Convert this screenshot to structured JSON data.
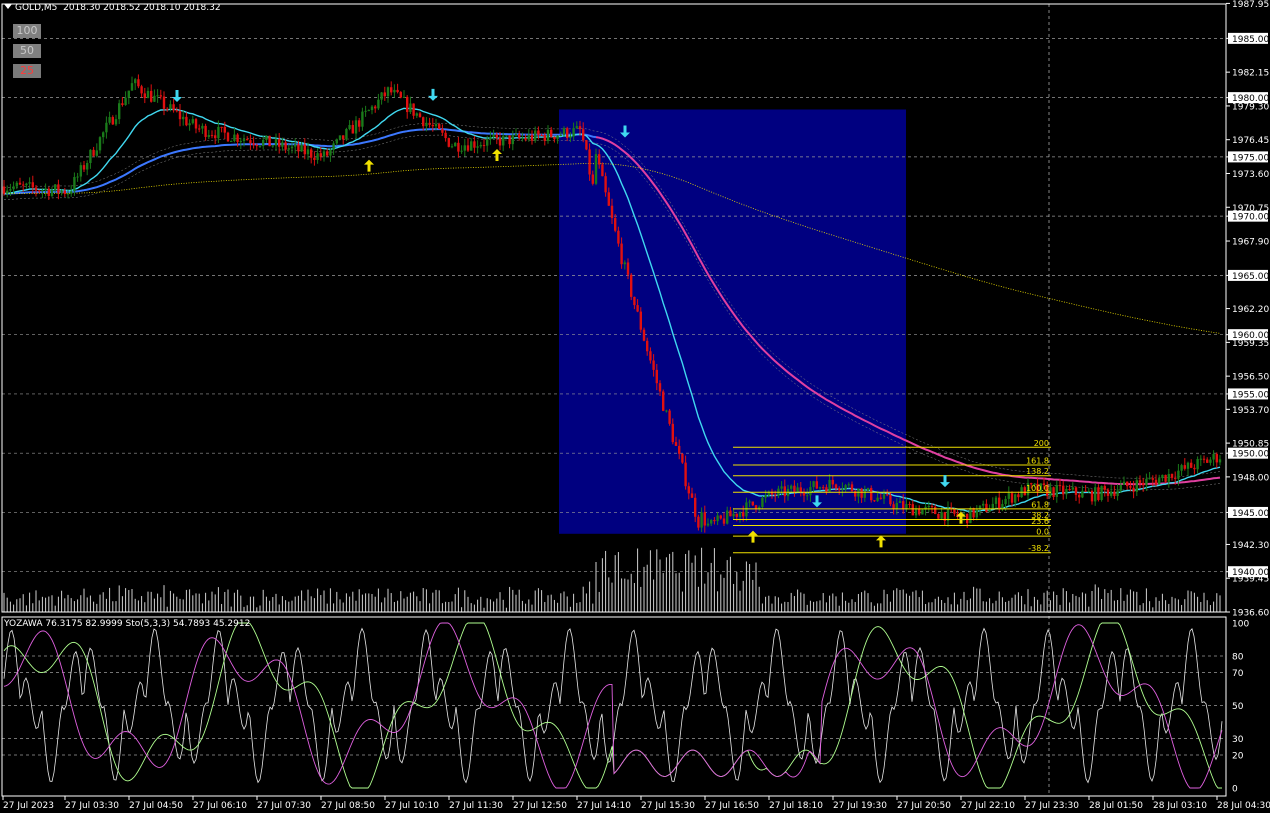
{
  "header": {
    "symbol": "GOLD,M5",
    "ohlc": "2018.30 2018.52 2018.10 2018.32"
  },
  "zoom_buttons": [
    {
      "label": "100"
    },
    {
      "label": "50"
    },
    {
      "label": "25"
    }
  ],
  "subwindow": {
    "label": "YOZAWA 76.3175 82.9999  Sto(5,3,3) 54.7893 45.2912"
  },
  "colors": {
    "bull": "#1a7a1a",
    "bear": "#e01010",
    "cyan_ma": "#40d8f0",
    "blue_ma": "#3c78ff",
    "magenta_ma": "#e040a0",
    "fib": "#f0e000",
    "highlight_box": "#000080",
    "grid": "#9a9a9a",
    "volume": "#d0d0d0"
  },
  "chart_data": [
    {
      "type": "candlestick",
      "title": "",
      "price_ylim": [
        1936.6,
        1987.9
      ],
      "price_ticks": [
        "1987.95",
        "1985.00",
        "1982.15",
        "1980.00",
        "1979.30",
        "1976.45",
        "1975.00",
        "1973.60",
        "1970.75",
        "1970.00",
        "1967.90",
        "1965.00",
        "1962.20",
        "1960.00",
        "1959.35",
        "1956.50",
        "1955.00",
        "1953.70",
        "1950.85",
        "1950.00",
        "1948.00",
        "1945.00",
        "1942.30",
        "1940.00",
        "1939.45",
        "1936.60"
      ],
      "boxed_price_ticks": [
        "1985.00",
        "1980.00",
        "1975.00",
        "1970.00",
        "1965.00",
        "1960.00",
        "1955.00",
        "1950.00",
        "1945.00",
        "1940.00"
      ],
      "time_labels": [
        "27 Jul 2023",
        "27 Jul 03:30",
        "27 Jul 04:50",
        "27 Jul 06:10",
        "27 Jul 07:30",
        "27 Jul 08:50",
        "27 Jul 10:10",
        "27 Jul 11:30",
        "27 Jul 12:50",
        "27 Jul 14:10",
        "27 Jul 15:30",
        "27 Jul 16:50",
        "27 Jul 18:10",
        "27 Jul 19:30",
        "27 Jul 20:50",
        "27 Jul 22:10",
        "27 Jul 23:30",
        "28 Jul 01:50",
        "28 Jul 03:10",
        "28 Jul 04:30"
      ],
      "key_closes": [
        {
          "time": "27 Jul 2023",
          "close": 1972.5
        },
        {
          "time": "27 Jul 03:30",
          "close": 1972.1
        },
        {
          "time": "27 Jul 04:50",
          "close": 1981.2
        },
        {
          "time": "27 Jul 06:10",
          "close": 1977.4
        },
        {
          "time": "27 Jul 07:30",
          "close": 1976.3
        },
        {
          "time": "27 Jul 08:50",
          "close": 1975.0
        },
        {
          "time": "27 Jul 10:10",
          "close": 1980.6
        },
        {
          "time": "27 Jul 11:30",
          "close": 1976.0
        },
        {
          "time": "27 Jul 12:50",
          "close": 1976.5
        },
        {
          "time": "27 Jul 14:10",
          "close": 1977.2
        },
        {
          "time": "27 Jul 15:30",
          "close": 1951.5
        },
        {
          "time": "27 Jul 16:50",
          "close": 1943.8
        },
        {
          "time": "27 Jul 18:10",
          "close": 1946.5
        },
        {
          "time": "27 Jul 19:30",
          "close": 1947.5
        },
        {
          "time": "27 Jul 20:50",
          "close": 1945.5
        },
        {
          "time": "27 Jul 22:10",
          "close": 1944.6
        },
        {
          "time": "27 Jul 23:30",
          "close": 1947.0
        },
        {
          "time": "28 Jul 01:50",
          "close": 1946.5
        },
        {
          "time": "28 Jul 03:10",
          "close": 1947.8
        },
        {
          "time": "28 Jul 04:30",
          "close": 1949.8
        }
      ],
      "fibonacci": {
        "levels": [
          {
            "label": "200",
            "price": 1950.5
          },
          {
            "label": "161.8",
            "price": 1949.0
          },
          {
            "label": "138.2",
            "price": 1948.1
          },
          {
            "label": "100.0",
            "price": 1946.7
          },
          {
            "label": "61.8",
            "price": 1945.3
          },
          {
            "label": "38.2",
            "price": 1944.4
          },
          {
            "label": "23.6",
            "price": 1943.9
          },
          {
            "label": "0.0",
            "price": 1943.0
          },
          {
            "label": "-38.2",
            "price": 1941.6
          }
        ],
        "from_time": "27 Jul 16:50",
        "to_time": "27 Jul 22:10"
      },
      "signal_arrows": [
        {
          "direction": "down",
          "time": "27 Jul 04:50",
          "price": 1979.8
        },
        {
          "direction": "up",
          "time": "27 Jul 08:50",
          "price": 1974.6
        },
        {
          "direction": "down",
          "time": "27 Jul 10:10",
          "price": 1979.9
        },
        {
          "direction": "up",
          "time": "27 Jul 11:30",
          "price": 1975.5
        },
        {
          "direction": "down",
          "time": "27 Jul 14:10",
          "price": 1976.8
        },
        {
          "direction": "up",
          "time": "27 Jul 16:50",
          "price": 1943.3
        },
        {
          "direction": "down",
          "time": "27 Jul 18:10",
          "price": 1945.6
        },
        {
          "direction": "up",
          "time": "27 Jul 19:30",
          "price": 1942.9
        },
        {
          "direction": "down",
          "time": "27 Jul 20:50",
          "price": 1947.3
        },
        {
          "direction": "up",
          "time": "27 Jul 20:50",
          "price": 1944.9
        }
      ],
      "highlight_region": {
        "from_time": "27 Jul 14:10",
        "to_time": "27 Jul 20:50",
        "price_from": 1943.2,
        "price_to": 1979.0
      },
      "current_time_marker": "27 Jul 23:30"
    },
    {
      "type": "line",
      "title": "",
      "ylim": [
        0,
        100
      ],
      "y_ticks": [
        "100",
        "80",
        "70",
        "50",
        "30",
        "20",
        "0"
      ],
      "levels": [
        80,
        70,
        50,
        30,
        20
      ]
    }
  ]
}
